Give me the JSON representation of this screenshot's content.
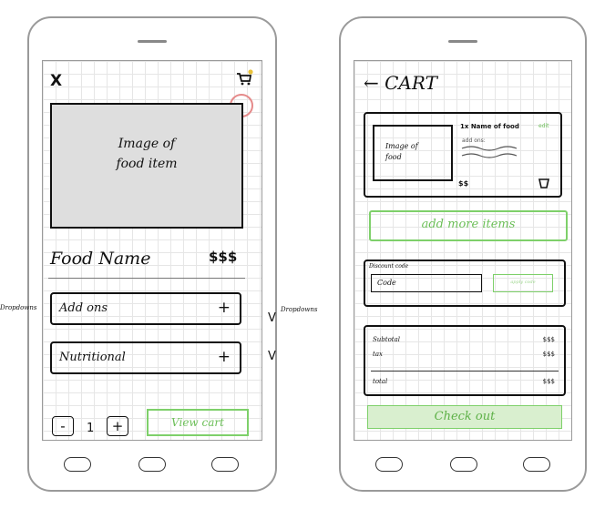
{
  "left_screen": {
    "close_label": "X",
    "image_label": "Image of\nfood item",
    "food_name": "Food Name",
    "price": "$$$",
    "addons_label": "Add ons",
    "addons_plus": "+",
    "nutrition_label": "Nutritional",
    "nutrition_plus": "+",
    "minus_label": "-",
    "quantity": "1",
    "plus_label": "+",
    "view_cart_label": "View cart"
  },
  "annotations": {
    "left_note": "Dropdowns",
    "right_note": "Dropdowns",
    "v_mark_addons": "V",
    "v_mark_nutrition": "V"
  },
  "right_screen": {
    "title": "← CART",
    "item_image_label": "Image of\nfood",
    "item_name": "1x Name of food",
    "item_edit": "edit",
    "item_addons": "add ons:",
    "item_price": "$$",
    "add_more_label": "add more items",
    "discount_label": "Discount code",
    "code_placeholder": "Code",
    "apply_label": "apply code",
    "subtotal_label": "Subtotal",
    "subtotal_value": "$$$",
    "tax_label": "tax",
    "tax_value": "$$$",
    "total_label": "total",
    "total_value": "$$$",
    "checkout_label": "Check out"
  },
  "colors": {
    "accent_green": "#7ed06a",
    "highlight_red": "#e58a8a",
    "image_fill": "#dedede"
  }
}
